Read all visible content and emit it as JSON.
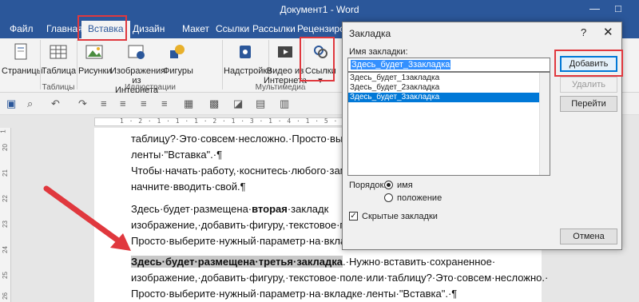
{
  "window": {
    "title": "Документ1 - Word"
  },
  "tabs": [
    {
      "label": "Файл"
    },
    {
      "label": "Главная"
    },
    {
      "label": "Вставка"
    },
    {
      "label": "Дизайн"
    },
    {
      "label": "Макет"
    },
    {
      "label": "Ссылки"
    },
    {
      "label": "Рассылки"
    },
    {
      "label": "Рецензирова"
    }
  ],
  "ribbon": {
    "pages": "Страницы",
    "table": "Таблица",
    "pictures": "Рисунки",
    "online_pictures_1": "Изображения",
    "online_pictures_2": "из Интернета",
    "shapes": "Фигуры",
    "addins": "Надстройки",
    "video_1": "Видео из",
    "video_2": "Интернета",
    "links": "Ссылки",
    "group_tables": "Таблицы",
    "group_illustrations": "Иллюстрации",
    "group_media": "Мультимедиа"
  },
  "ruler": {
    "ticks": "1 · 2 · 1 · 1 · 1 · 2 · 1 · 3 · 1 · 4 · 1 · 5 · 1 · 6"
  },
  "vruler": [
    "1",
    "20",
    "21",
    "22",
    "23",
    "24",
    "25",
    "26"
  ],
  "document": {
    "line1": "таблицу?·Это·совсем·несложно.·Просто·выбе",
    "line2": "ленты·\"Вставка\".·¶",
    "line3": "Чтобы·начать·работу,·коснитесь·любого·заме",
    "line4": "начните·вводить·свой.¶",
    "line5a": "Здесь·будет·размещена·",
    "line5b": "вторая",
    "line5c": "·закладк",
    "line6": "изображение,·добавить·фигуру,·текстовое·пол",
    "line7": "Просто·выберите·нужный·параметр·на·вкладк",
    "line8a": "Здесь·будет·размещена·третья·закладка",
    "line8b": ".·Нужно·вставить·сохраненное·",
    "line9": "изображение,·добавить·фигуру,·текстовое·поле·или·таблицу?·Это·совсем·несложно.·",
    "line10": "Просто·выберите·нужный·параметр·на·вкладке·ленты·\"Вставка\".·¶"
  },
  "dialog": {
    "title": "Закладка",
    "help": "?",
    "close": "✕",
    "name_label": "Имя закладки:",
    "name_value": "Здесь_будет_3закладка",
    "items": [
      "Здесь_будет_1закладка",
      "Здесь_будет_2закладка",
      "Здесь_будет_3закладка"
    ],
    "add": "Добавить",
    "delete": "Удалить",
    "goto": "Перейти",
    "order_label": "Порядок:",
    "order_name": "имя",
    "order_position": "положение",
    "hidden_label": "Скрытые закладки",
    "cancel": "Отмена"
  },
  "colors": {
    "brand": "#2b579a",
    "highlight_red": "#e0383e",
    "selection": "#0078d7"
  }
}
